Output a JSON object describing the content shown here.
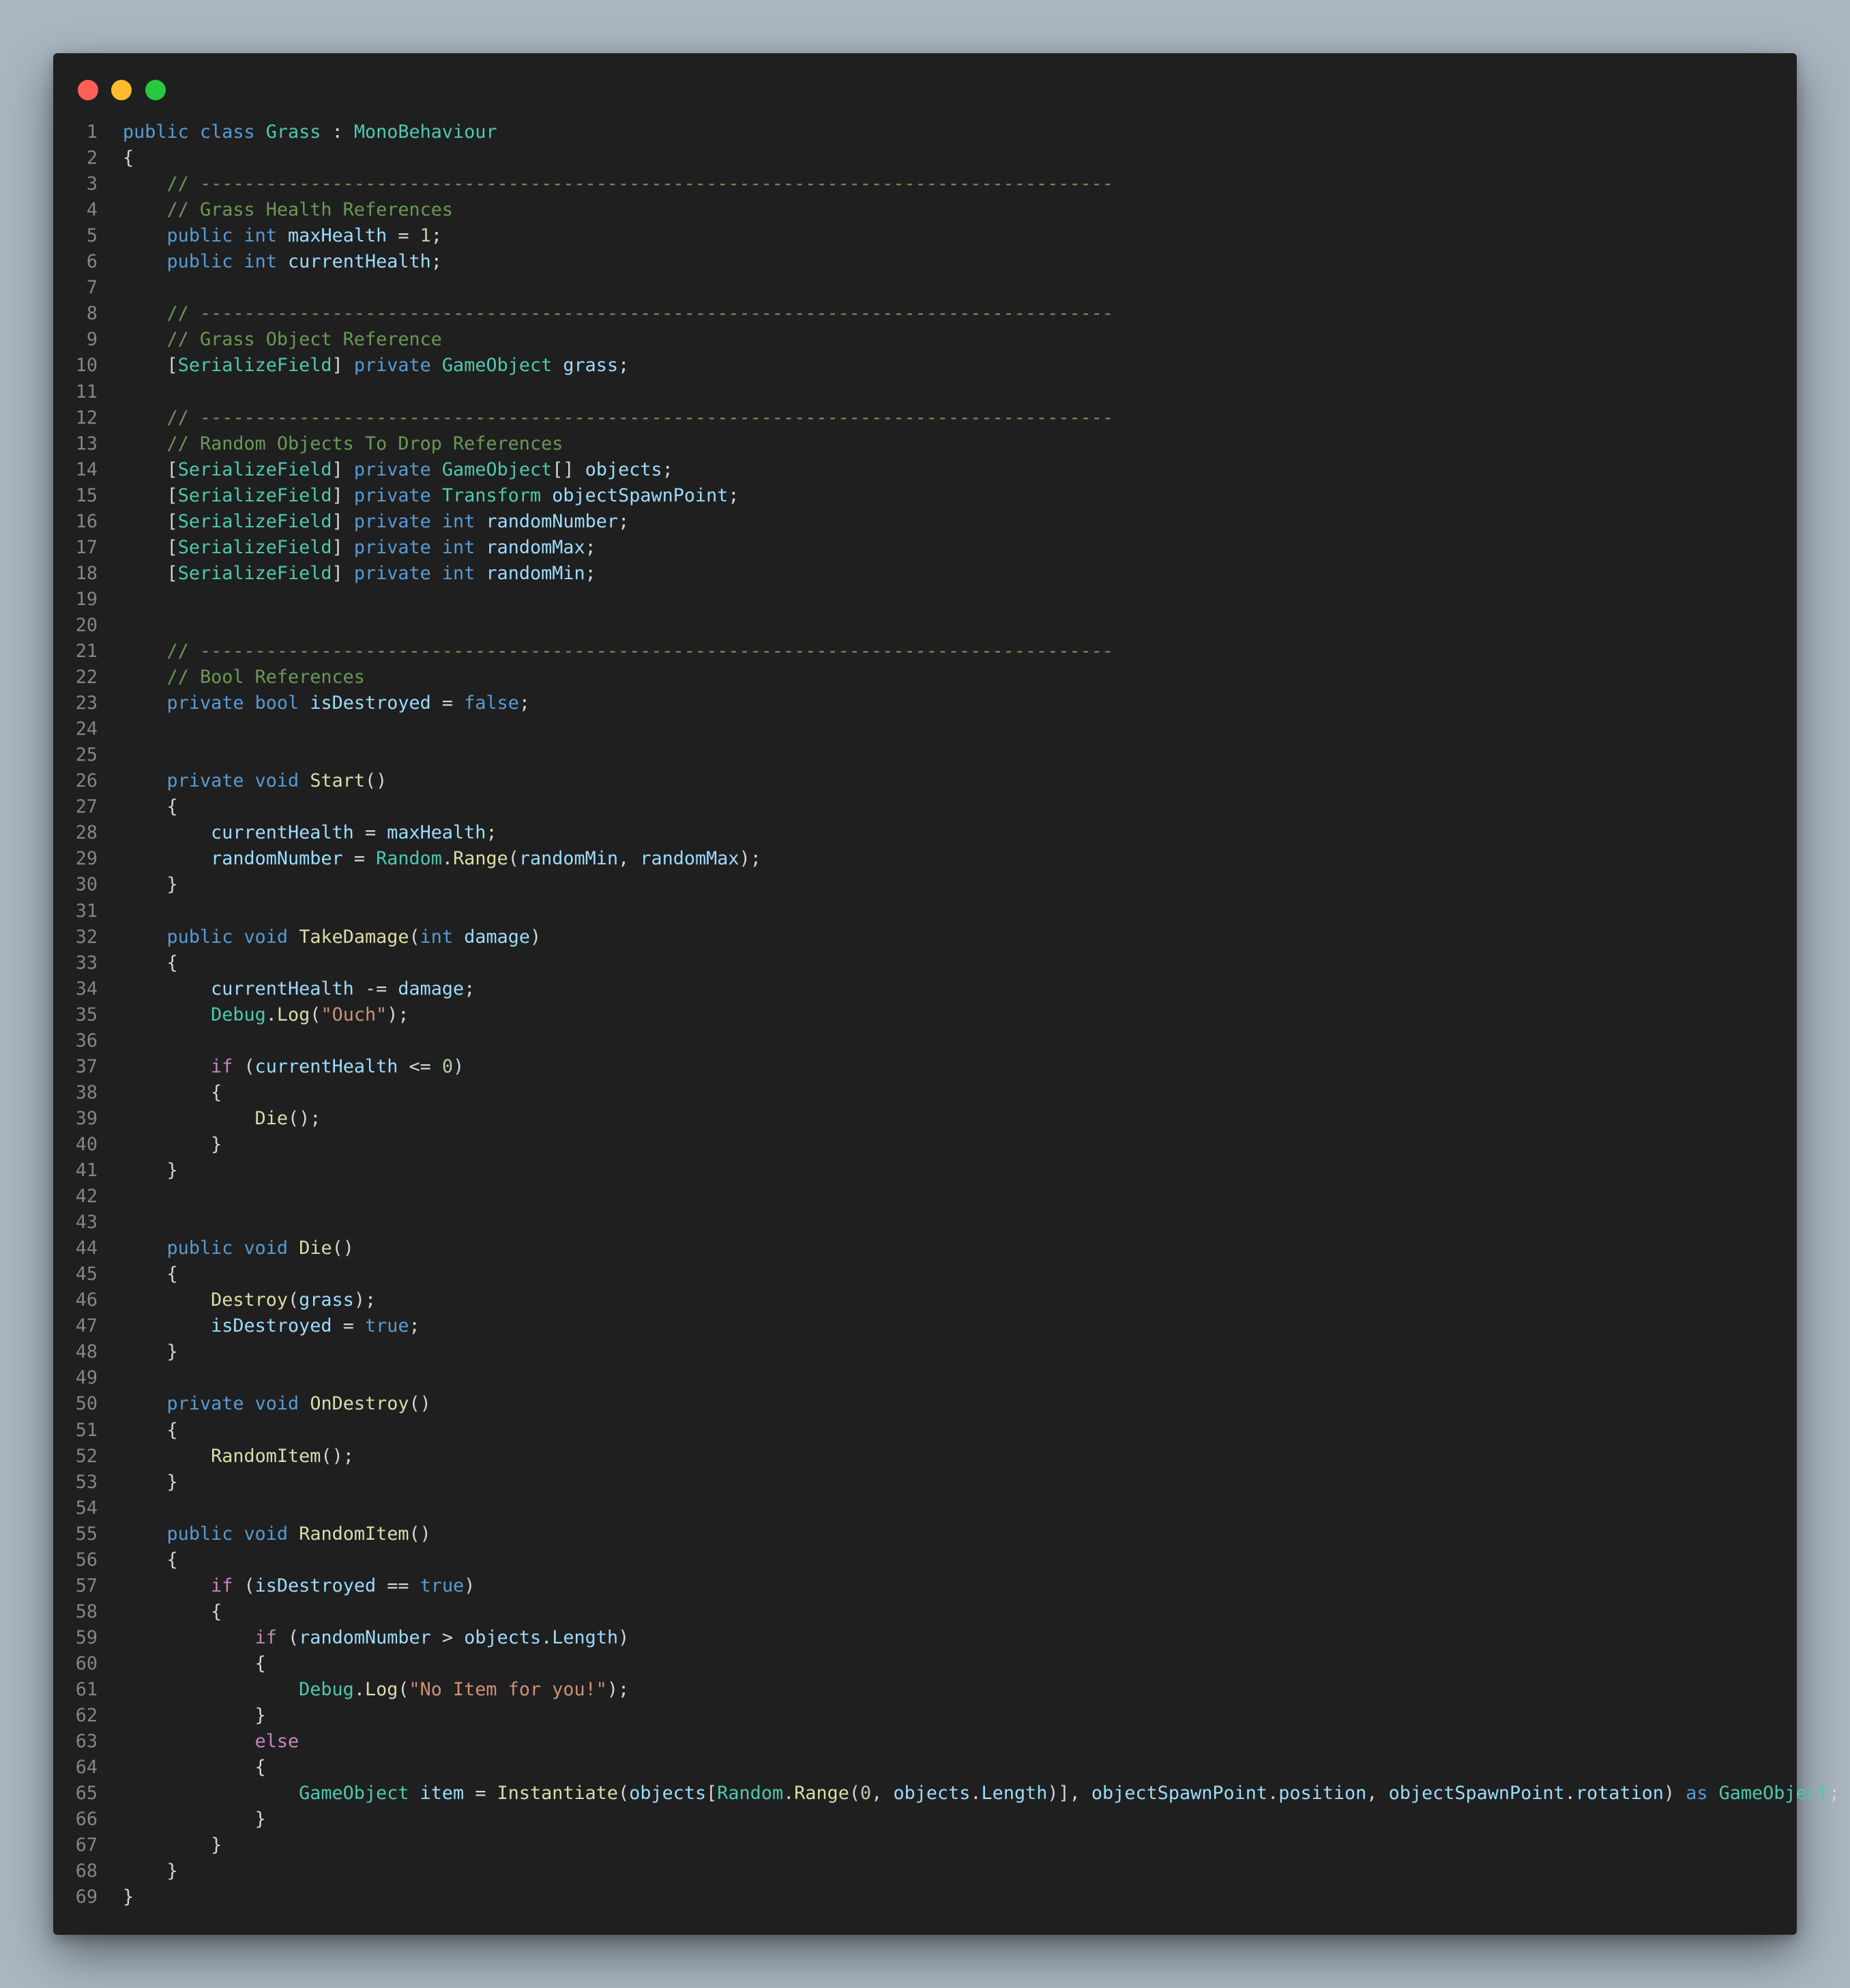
{
  "window": {
    "controls": [
      {
        "name": "close",
        "color": "#ff5f57"
      },
      {
        "name": "minimize",
        "color": "#febc2e"
      },
      {
        "name": "maximize",
        "color": "#28c840"
      }
    ]
  },
  "editor": {
    "language": "csharp",
    "theme_colors": {
      "background": "#1f1f1f",
      "keyword": "#569cd6",
      "control": "#c586c0",
      "type": "#4ec9b0",
      "variable": "#9cdcfe",
      "function": "#dcdcaa",
      "string": "#ce9178",
      "number": "#b5cea8",
      "comment": "#6a9955",
      "line_number": "#858585"
    },
    "lines": [
      "public class Grass : MonoBehaviour",
      "{",
      "    // -----------------------------------------------------------------------------------",
      "    // Grass Health References",
      "    public int maxHealth = 1;",
      "    public int currentHealth;",
      "",
      "    // -----------------------------------------------------------------------------------",
      "    // Grass Object Reference",
      "    [SerializeField] private GameObject grass;",
      "",
      "    // -----------------------------------------------------------------------------------",
      "    // Random Objects To Drop References",
      "    [SerializeField] private GameObject[] objects;",
      "    [SerializeField] private Transform objectSpawnPoint;",
      "    [SerializeField] private int randomNumber;",
      "    [SerializeField] private int randomMax;",
      "    [SerializeField] private int randomMin;",
      "",
      "",
      "    // -----------------------------------------------------------------------------------",
      "    // Bool References",
      "    private bool isDestroyed = false;",
      "",
      "",
      "    private void Start()",
      "    {",
      "        currentHealth = maxHealth;",
      "        randomNumber = Random.Range(randomMin, randomMax);",
      "    }",
      "",
      "    public void TakeDamage(int damage)",
      "    {",
      "        currentHealth -= damage;",
      "        Debug.Log(\"Ouch\");",
      "",
      "        if (currentHealth <= 0)",
      "        {",
      "            Die();",
      "        }",
      "    }",
      "",
      "",
      "    public void Die()",
      "    {",
      "        Destroy(grass);",
      "        isDestroyed = true;",
      "    }",
      "",
      "    private void OnDestroy()",
      "    {",
      "        RandomItem();",
      "    }",
      "",
      "    public void RandomItem()",
      "    {",
      "        if (isDestroyed == true)",
      "        {",
      "            if (randomNumber > objects.Length)",
      "            {",
      "                Debug.Log(\"No Item for you!\");",
      "            }",
      "            else",
      "            {",
      "                GameObject item = Instantiate(objects[Random.Range(0, objects.Length)], objectSpawnPoint.position, objectSpawnPoint.rotation) as GameObject;",
      "            }",
      "        }",
      "    }",
      "}"
    ]
  }
}
